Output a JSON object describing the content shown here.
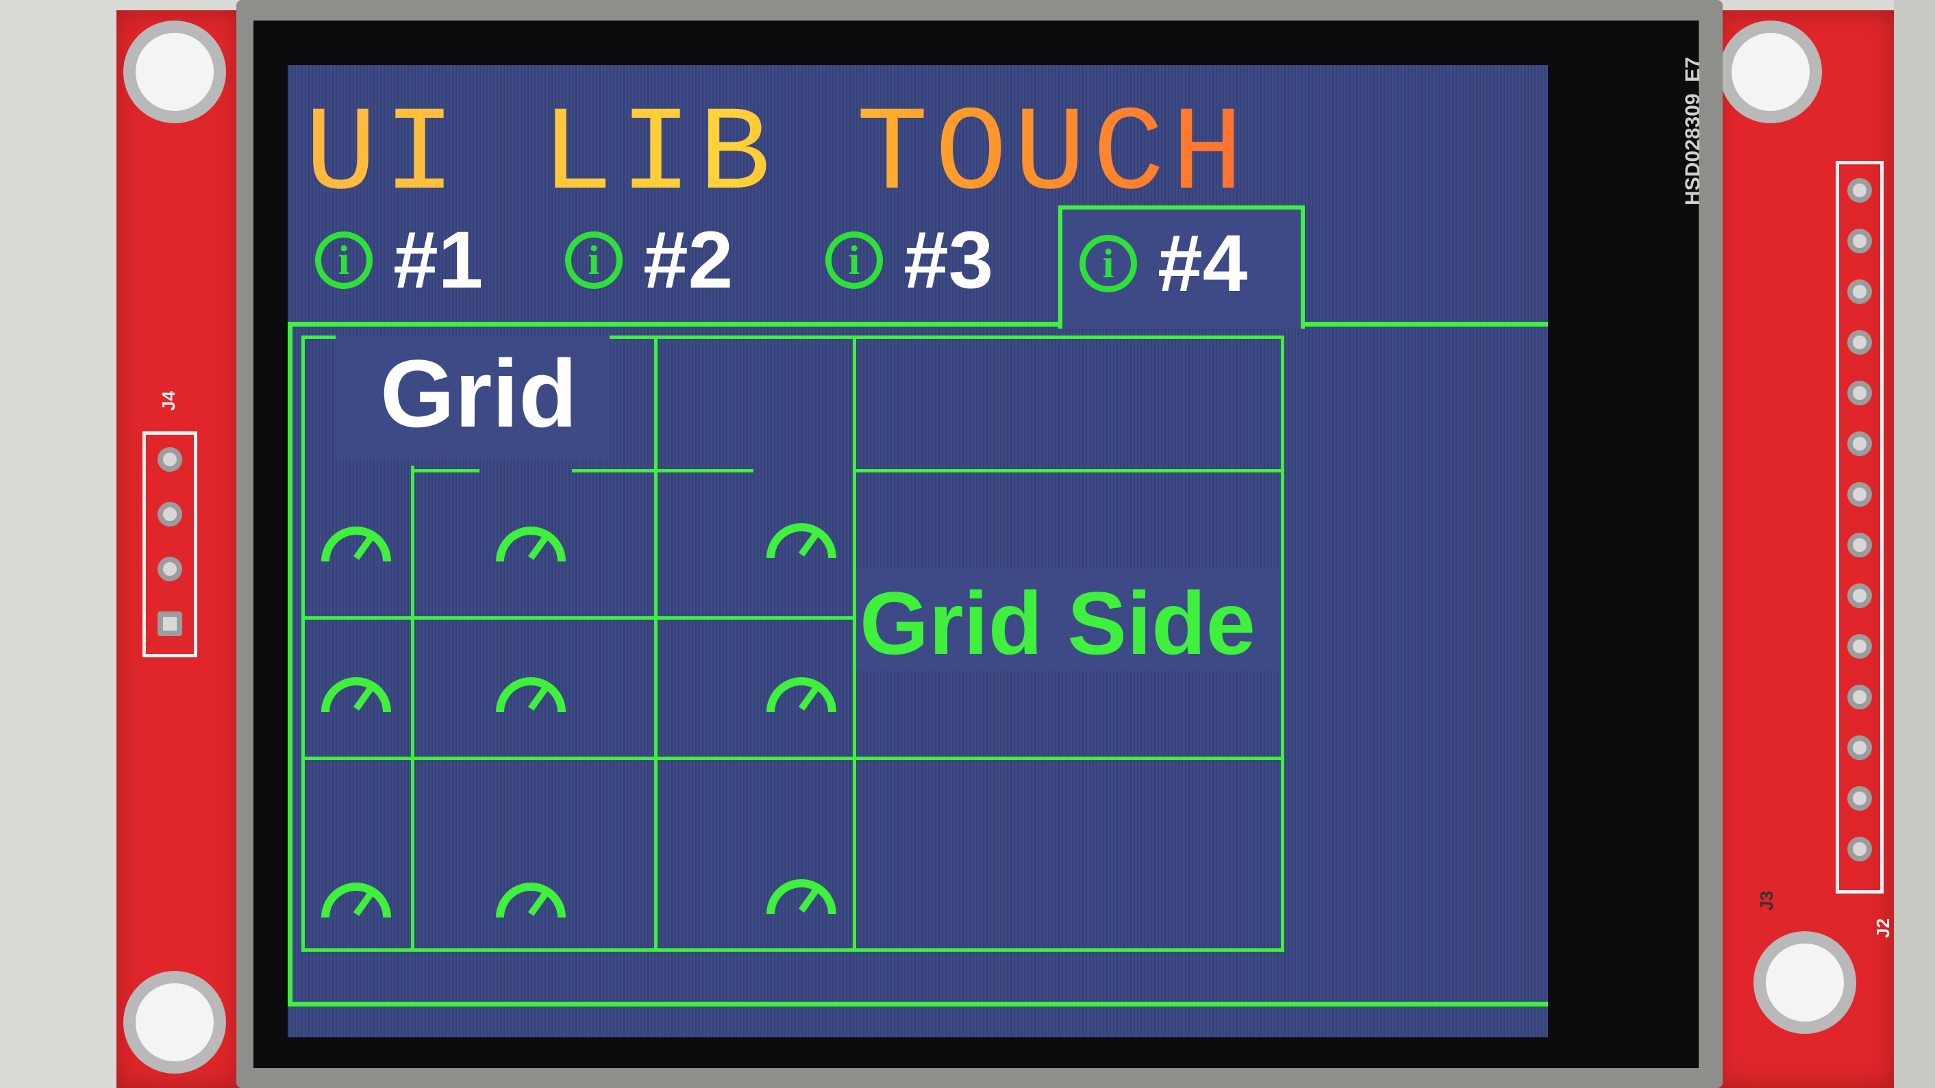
{
  "app": {
    "title": "UI LIB TOUCH"
  },
  "tabs": [
    {
      "icon": "info-icon",
      "glyph": "i",
      "label": "#1",
      "active": false
    },
    {
      "icon": "info-icon",
      "glyph": "i",
      "label": "#2",
      "active": false
    },
    {
      "icon": "info-icon",
      "glyph": "i",
      "label": "#3",
      "active": false
    },
    {
      "icon": "info-icon",
      "glyph": "i",
      "label": "#4",
      "active": true
    }
  ],
  "grid": {
    "title": "Grid",
    "side_label": "Grid Side",
    "gauge_icon": "gauge-icon"
  },
  "board": {
    "left_connector": "J4",
    "right_connector": "J2",
    "aux_connector": "J3",
    "model": "HSD028309",
    "revision": "E7"
  },
  "colors": {
    "accent": "#3ff03c",
    "screen_bg": "#3d4a86",
    "title_gradient": [
      "#ffb840",
      "#ffd23a",
      "#ff7030"
    ],
    "pcb": "#e0262a"
  }
}
